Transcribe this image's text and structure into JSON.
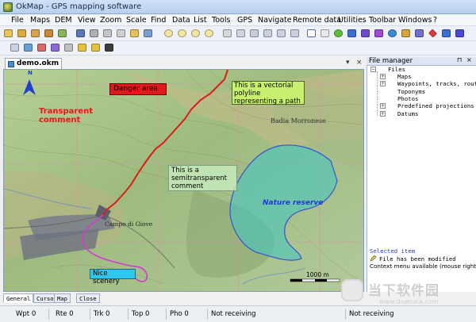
{
  "window": {
    "title": "OkMap - GPS mapping software"
  },
  "menu": [
    "File",
    "Maps",
    "DEM",
    "View",
    "Zoom",
    "Scale",
    "Find",
    "Data",
    "List",
    "Tools",
    "GPS",
    "Navigate",
    "Remote data",
    "Utilities",
    "Toolbar",
    "Windows",
    "?"
  ],
  "document_tab": {
    "label": "demo.okm",
    "dropdown": "▾",
    "close": "×"
  },
  "map": {
    "annotations": {
      "danger": "Danger area",
      "polyline": "This is a vectorial polyline representing a path",
      "transparent": "Transparent comment",
      "semitransparent": "This is a semitransparent comment",
      "nature": "Nature reserve",
      "scenery": "Nice scenery"
    },
    "place_labels": {
      "campo": "Campo di Giove",
      "badia": "Badia Morronese"
    },
    "scale_label": "1000 m",
    "compass": "N"
  },
  "file_manager": {
    "title": "File manager",
    "pin": "⊓",
    "close": "×",
    "tree": {
      "root": "Files",
      "children": [
        "Maps",
        "Waypoints, tracks, routes",
        "Toponyms",
        "Photos",
        "Predefined projections",
        "Datums"
      ]
    },
    "selected_label": "Selected item",
    "modified_text": "File has been modified",
    "context_hint": "Context menu available (mouse right click)"
  },
  "bottom_tabs": [
    "General",
    "Cursor",
    "Map",
    "Close"
  ],
  "status": {
    "wpt": "Wpt 0",
    "rte": "Rte 0",
    "trk": "Trk 0",
    "top": "Top 0",
    "pho": "Pho 0",
    "receiving_1": "Not receiving",
    "receiving_2": "Not receiving"
  },
  "watermark": {
    "cn": "当下软件园",
    "url": "www.downxia.com"
  },
  "colors": {
    "danger": "#e01a1a",
    "polyline_box": "#c9f06f",
    "semitransparent_box": "#c8ecc0",
    "nature": "#3dc7c4",
    "nature_text": "#1f3bd0",
    "scenery_box": "#2fc7f0",
    "path_red": "#e01a1a",
    "path_magenta": "#d43ad4",
    "selected": "#1e36ce"
  }
}
